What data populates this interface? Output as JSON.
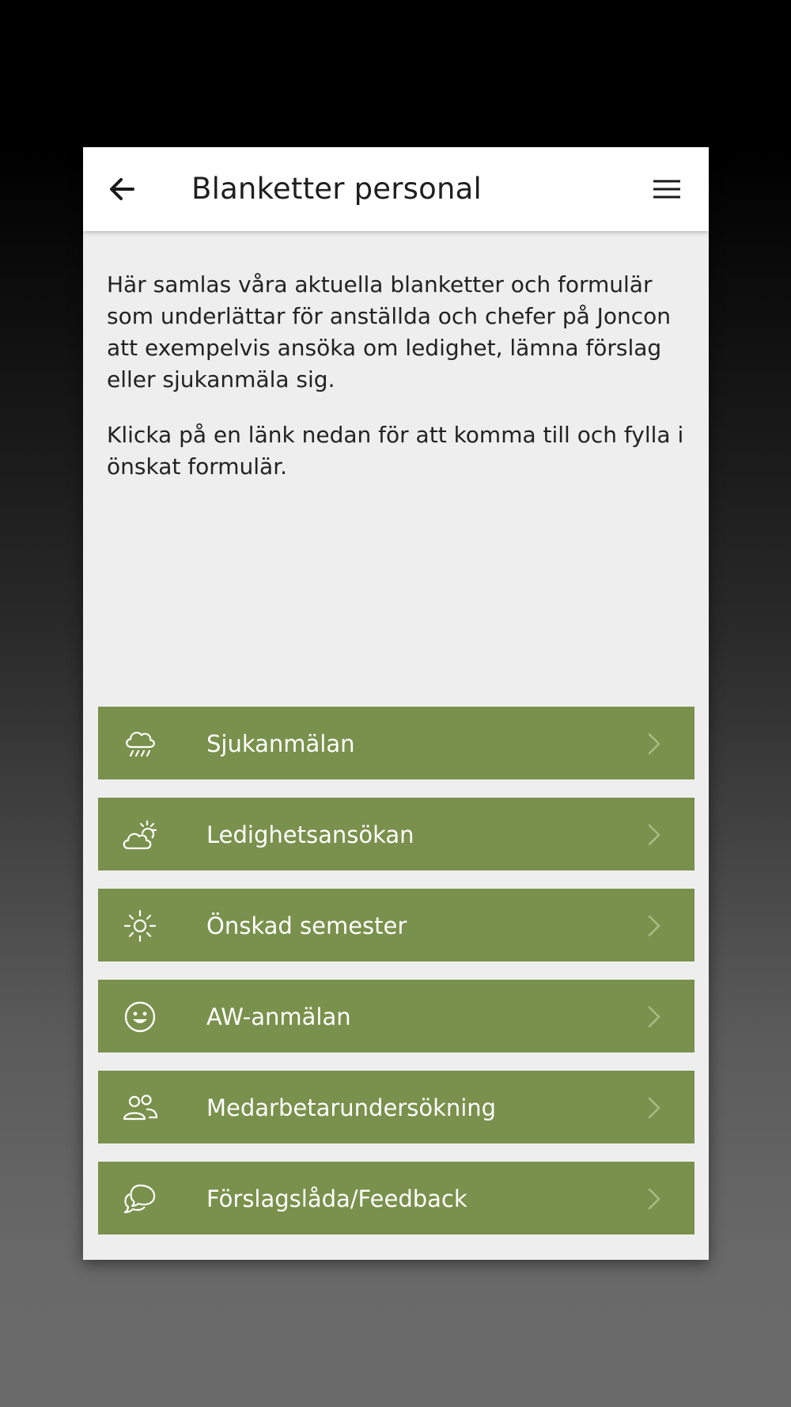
{
  "header": {
    "title": "Blanketter personal",
    "back_icon": "arrow-left-icon",
    "menu_icon": "hamburger-menu-icon"
  },
  "intro": {
    "paragraph1": "Här samlas våra aktuella blanketter och formulär som underlättar för anställda och chefer på Joncon att exempelvis ansöka om ledighet, lämna förslag eller sjukanmäla sig.",
    "paragraph2": "Klicka på en länk nedan för att komma till och fylla i önskat formulär."
  },
  "colors": {
    "item_background": "#79914c",
    "page_background": "#eeeeee",
    "header_background": "#ffffff"
  },
  "items": [
    {
      "label": "Sjukanmälan",
      "icon": "rain-cloud-icon"
    },
    {
      "label": "Ledighetsansökan",
      "icon": "partly-cloudy-icon"
    },
    {
      "label": "Önskad semester",
      "icon": "sun-icon"
    },
    {
      "label": "AW-anmälan",
      "icon": "smiley-icon"
    },
    {
      "label": "Medarbetarundersökning",
      "icon": "people-icon"
    },
    {
      "label": "Förslagslåda/Feedback",
      "icon": "chat-bubbles-icon"
    }
  ]
}
